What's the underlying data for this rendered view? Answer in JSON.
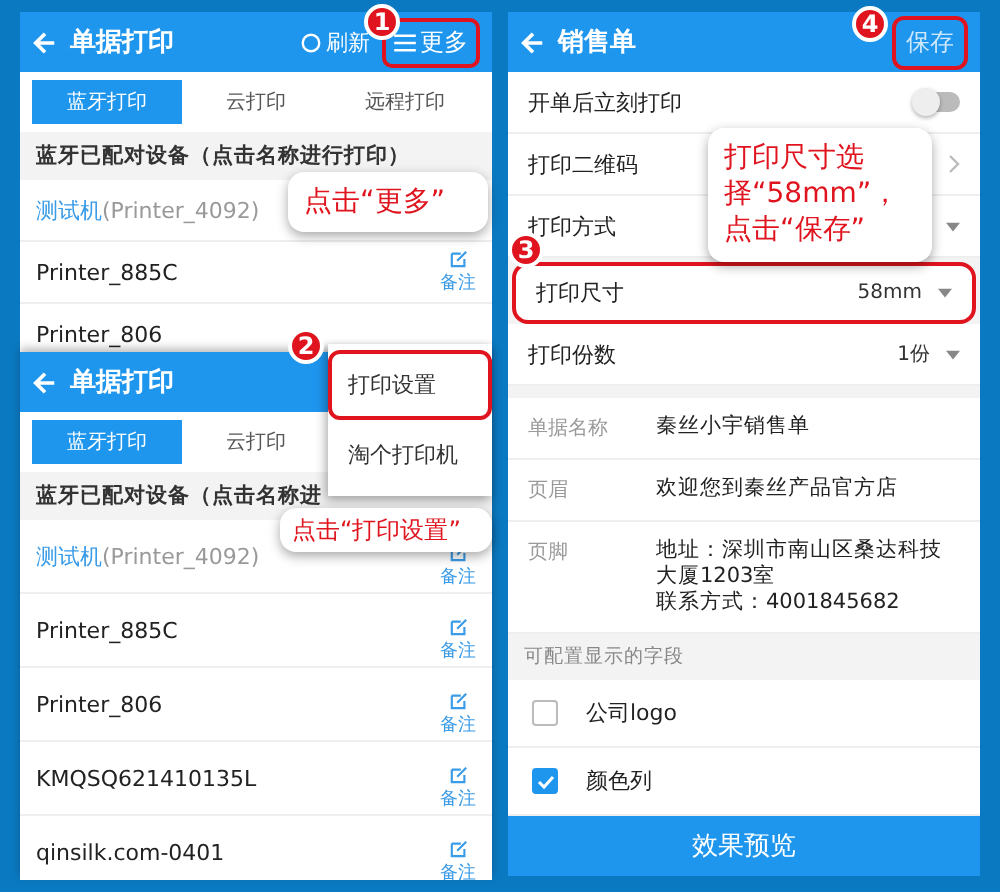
{
  "left_panel": {
    "screen_1": {
      "header": {
        "title": "单据打印",
        "refresh": "刷新",
        "more": {
          "label": "更多",
          "highlighted": true
        }
      },
      "tabs": [
        {
          "label": "蓝牙打印",
          "selected": true
        },
        {
          "label": "云打印",
          "selected": false
        },
        {
          "label": "远程打印",
          "selected": false
        }
      ],
      "section_title": "蓝牙已配对设备（点击名称进行打印）",
      "printers": [
        {
          "name": "测试机",
          "model": "(Printer_4092)"
        },
        {
          "name": "Printer_885C",
          "note": "备注"
        },
        {
          "name": "Printer_806"
        }
      ]
    },
    "screen_2": {
      "header": {
        "title": "单据打印"
      },
      "tabs": [
        {
          "label": "蓝牙打印",
          "selected": true
        },
        {
          "label": "云打印",
          "selected": false
        }
      ],
      "section_title": "蓝牙已配对设备（点击名称进",
      "printers": [
        {
          "name": "测试机",
          "model": "(Printer_4092)",
          "note": "备注"
        },
        {
          "name": "Printer_885C",
          "note": "备注"
        },
        {
          "name": "Printer_806",
          "note": "备注"
        },
        {
          "name": "KMQSQ621410135L",
          "note": "备注"
        },
        {
          "name": "qinsilk.com-0401",
          "note": "备注"
        }
      ]
    },
    "menu": [
      {
        "label": "打印设置",
        "highlighted": true
      },
      {
        "label": "淘个打印机",
        "highlighted": false
      }
    ]
  },
  "right_panel": {
    "header": {
      "title": "销售单",
      "save": {
        "label": "保存",
        "highlighted": true
      }
    },
    "settings": [
      {
        "kind": "toggle",
        "label": "开单后立刻打印",
        "on": false
      },
      {
        "kind": "link",
        "label": "打印二维码"
      },
      {
        "kind": "select",
        "label": "打印方式"
      },
      {
        "kind": "select",
        "label": "打印尺寸",
        "value": "58mm",
        "highlighted": true
      },
      {
        "kind": "select",
        "label": "打印份数",
        "value": "1份",
        "highlighted": false
      }
    ],
    "fields": [
      {
        "label": "单据名称",
        "lines": [
          "秦丝小宇销售单"
        ]
      },
      {
        "label": "页眉",
        "lines": [
          "欢迎您到秦丝产品官方店"
        ]
      },
      {
        "label": "页脚",
        "lines": [
          "地址：深圳市南山区桑达科技大厦1203室",
          "联系方式：4001845682"
        ]
      }
    ],
    "fields_section": "可配置显示的字段",
    "checkboxes": [
      {
        "label": "公司logo",
        "checked": false
      },
      {
        "label": "颜色列",
        "checked": true
      }
    ],
    "preview_button": "效果预览"
  },
  "badges": [
    "1",
    "2",
    "3",
    "4"
  ],
  "callouts": [
    "点击“更多”",
    "点击“打印设置”",
    "打印尺寸选择“58mm”，点击“保存”"
  ]
}
